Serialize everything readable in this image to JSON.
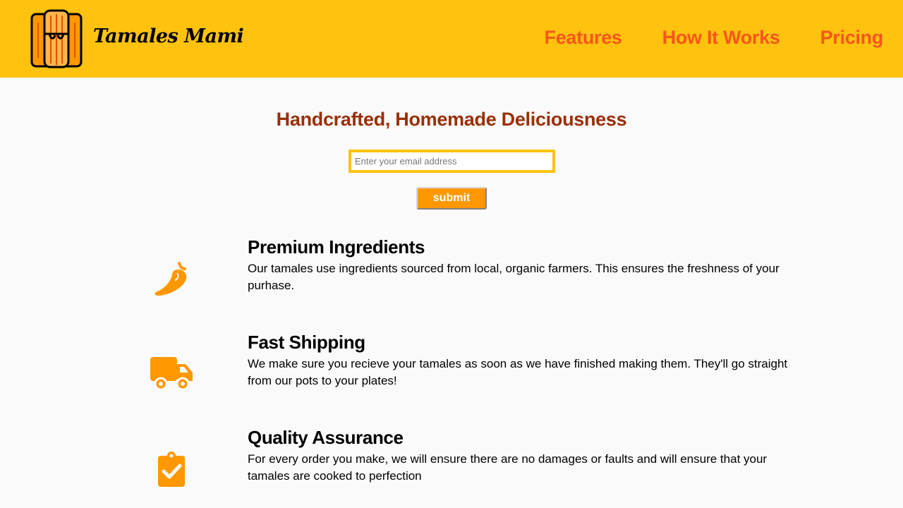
{
  "header": {
    "brand": "Tamales Mami",
    "logo_icon": "tamale-logo-icon",
    "nav": [
      {
        "label": "Features"
      },
      {
        "label": "How It Works"
      },
      {
        "label": "Pricing"
      }
    ]
  },
  "hero": {
    "title": "Handcrafted, Homemade Deliciousness",
    "email_placeholder": "Enter your email address",
    "email_value": "",
    "submit_label": "submit"
  },
  "features": [
    {
      "icon": "chili-pepper-icon",
      "title": "Premium Ingredients",
      "text": "Our tamales use ingredients sourced from local, organic farmers. This ensures the freshness of your purhase."
    },
    {
      "icon": "truck-icon",
      "title": "Fast Shipping",
      "text": "We make sure you recieve your tamales as soon as we have finished making them. They'll go straight from our pots to your plates!"
    },
    {
      "icon": "clipboard-check-icon",
      "title": "Quality Assurance",
      "text": "For every order you make, we will ensure there are no damages or faults and will ensure that your tamales are cooked to perfection"
    }
  ],
  "colors": {
    "header_bg": "#ffc20e",
    "nav_link": "#f7561b",
    "hero_title": "#992f07",
    "accent_orange": "#ff9800",
    "page_bg": "#fafafa"
  }
}
